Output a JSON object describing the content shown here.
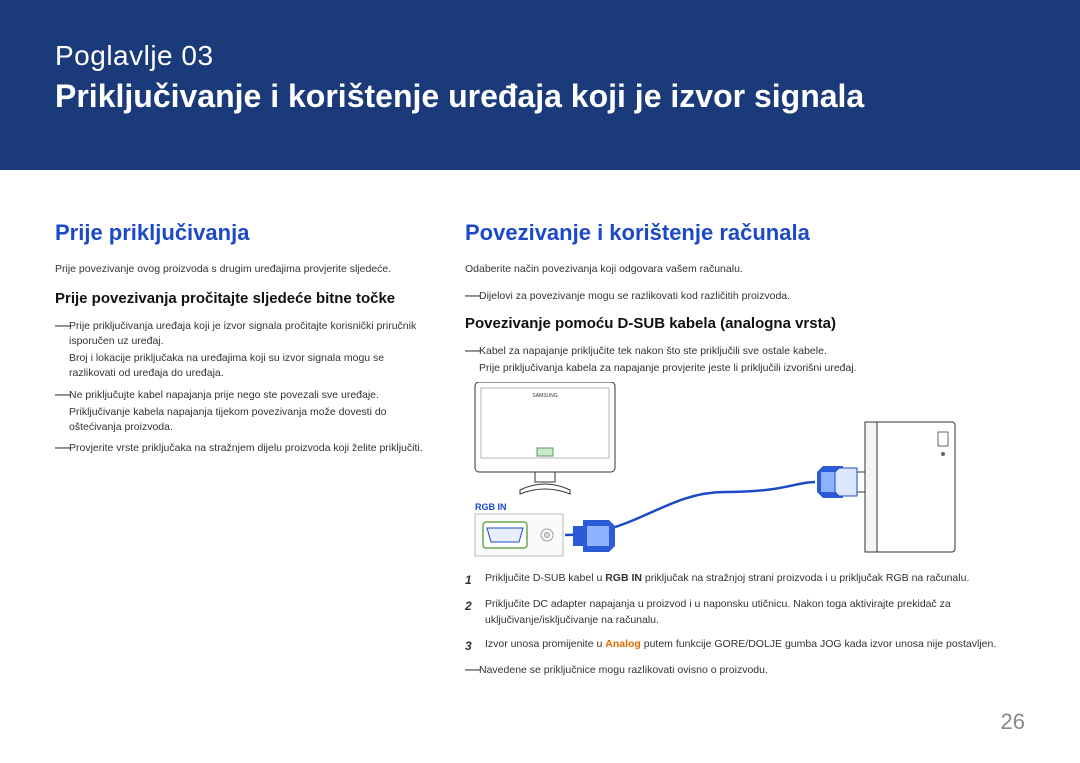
{
  "banner": {
    "chapter": "Poglavlje  03",
    "title": "Priključivanje i korištenje uređaja koji je izvor signala"
  },
  "left": {
    "heading": "Prije priključivanja",
    "intro": "Prije povezivanje ovog proizvoda s drugim uređajima provjerite sljedeće.",
    "subhead": "Prije povezivanja pročitajte sljedeće bitne točke",
    "items": [
      {
        "main": "Prije priključivanja uređaja koji je izvor signala pročitajte korisnički priručnik isporučen uz uređaj.",
        "sub": "Broj i lokacije priključaka na uređajima koji su izvor signala mogu se razlikovati od uređaja do uređaja."
      },
      {
        "main": "Ne priključujte kabel napajanja prije nego ste povezali sve uređaje.",
        "sub": "Priključivanje kabela napajanja tijekom povezivanja može dovesti do oštećivanja proizvoda."
      },
      {
        "main": "Provjerite vrste priključaka na stražnjem dijelu proizvoda koji želite priključiti."
      }
    ]
  },
  "right": {
    "heading": "Povezivanje i korištenje računala",
    "intro": "Odaberite način povezivanja koji odgovara vašem računalu.",
    "note1": "Dijelovi za povezivanje mogu se razlikovati kod različitih proizvoda.",
    "subhead": "Povezivanje pomoću D-SUB kabela (analogna vrsta)",
    "note2_main": "Kabel za napajanje priključite tek nakon što ste priključili sve ostale kabele.",
    "note2_sub": "Prije priključivanja kabela za napajanje provjerite jeste li priključili izvorišni uređaj.",
    "diagram": {
      "port_label": "RGB IN",
      "monitor_brand": "SAMSUNG"
    },
    "steps": [
      {
        "n": "1",
        "pre": "Priključite D-SUB kabel u ",
        "bold": "RGB IN",
        "post": " priključak na stražnjoj strani proizvoda i u priključak RGB na računalu."
      },
      {
        "n": "2",
        "text": "Priključite DC adapter napajanja u proizvod i u naponsku utičnicu. Nakon toga aktivirajte prekidač za uključivanje/isključivanje na računalu."
      },
      {
        "n": "3",
        "pre": "Izvor unosa promijenite u ",
        "orange": "Analog",
        "post": " putem funkcije GORE/DOLJE gumba JOG kada izvor unosa nije postavljen."
      }
    ],
    "note3": "Navedene se priključnice mogu razlikovati ovisno o proizvodu."
  },
  "page_number": "26"
}
